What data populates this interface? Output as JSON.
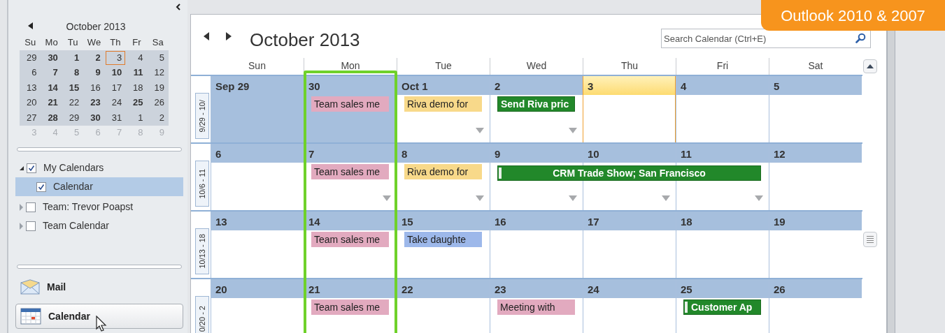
{
  "badge": {
    "text": "Outlook 2010 & 2007"
  },
  "mini_calendar": {
    "title": "October 2013",
    "weekdays": [
      "Su",
      "Mo",
      "Tu",
      "We",
      "Th",
      "Fr",
      "Sa"
    ],
    "weeks": [
      [
        {
          "label": "29",
          "bold": false,
          "today": false,
          "dimmed": false
        },
        {
          "label": "30",
          "bold": true,
          "today": false,
          "dimmed": false
        },
        {
          "label": "1",
          "bold": true,
          "today": false,
          "dimmed": false
        },
        {
          "label": "2",
          "bold": true,
          "today": false,
          "dimmed": false
        },
        {
          "label": "3",
          "bold": false,
          "today": true,
          "dimmed": false
        },
        {
          "label": "4",
          "bold": false,
          "today": false,
          "dimmed": false
        },
        {
          "label": "5",
          "bold": false,
          "today": false,
          "dimmed": false
        }
      ],
      [
        {
          "label": "6",
          "bold": false,
          "today": false,
          "dimmed": false
        },
        {
          "label": "7",
          "bold": true,
          "today": false,
          "dimmed": false
        },
        {
          "label": "8",
          "bold": true,
          "today": false,
          "dimmed": false
        },
        {
          "label": "9",
          "bold": true,
          "today": false,
          "dimmed": false
        },
        {
          "label": "10",
          "bold": true,
          "today": false,
          "dimmed": false
        },
        {
          "label": "11",
          "bold": true,
          "today": false,
          "dimmed": false
        },
        {
          "label": "12",
          "bold": false,
          "today": false,
          "dimmed": false
        }
      ],
      [
        {
          "label": "13",
          "bold": false,
          "today": false,
          "dimmed": false
        },
        {
          "label": "14",
          "bold": true,
          "today": false,
          "dimmed": false
        },
        {
          "label": "15",
          "bold": true,
          "today": false,
          "dimmed": false
        },
        {
          "label": "16",
          "bold": false,
          "today": false,
          "dimmed": false
        },
        {
          "label": "17",
          "bold": false,
          "today": false,
          "dimmed": false
        },
        {
          "label": "18",
          "bold": false,
          "today": false,
          "dimmed": false
        },
        {
          "label": "19",
          "bold": false,
          "today": false,
          "dimmed": false
        }
      ],
      [
        {
          "label": "20",
          "bold": false,
          "today": false,
          "dimmed": false
        },
        {
          "label": "21",
          "bold": true,
          "today": false,
          "dimmed": false
        },
        {
          "label": "22",
          "bold": false,
          "today": false,
          "dimmed": false
        },
        {
          "label": "23",
          "bold": true,
          "today": false,
          "dimmed": false
        },
        {
          "label": "24",
          "bold": false,
          "today": false,
          "dimmed": false
        },
        {
          "label": "25",
          "bold": true,
          "today": false,
          "dimmed": false
        },
        {
          "label": "26",
          "bold": false,
          "today": false,
          "dimmed": false
        }
      ],
      [
        {
          "label": "27",
          "bold": false,
          "today": false,
          "dimmed": false
        },
        {
          "label": "28",
          "bold": true,
          "today": false,
          "dimmed": false
        },
        {
          "label": "29",
          "bold": false,
          "today": false,
          "dimmed": false
        },
        {
          "label": "30",
          "bold": true,
          "today": false,
          "dimmed": false
        },
        {
          "label": "31",
          "bold": false,
          "today": false,
          "dimmed": false
        },
        {
          "label": "1",
          "bold": false,
          "today": false,
          "dimmed": false
        },
        {
          "label": "2",
          "bold": false,
          "today": false,
          "dimmed": false
        }
      ],
      [
        {
          "label": "3",
          "bold": false,
          "today": false,
          "dimmed": true
        },
        {
          "label": "4",
          "bold": false,
          "today": false,
          "dimmed": true
        },
        {
          "label": "5",
          "bold": false,
          "today": false,
          "dimmed": true
        },
        {
          "label": "6",
          "bold": false,
          "today": false,
          "dimmed": true
        },
        {
          "label": "7",
          "bold": false,
          "today": false,
          "dimmed": true
        },
        {
          "label": "8",
          "bold": false,
          "today": false,
          "dimmed": true
        },
        {
          "label": "9",
          "bold": false,
          "today": false,
          "dimmed": true
        }
      ]
    ]
  },
  "calendar_tree": [
    {
      "label": "My Calendars",
      "checked": true,
      "expanded": true,
      "selected": false,
      "children": [
        {
          "label": "Calendar",
          "checked": true,
          "selected": true
        }
      ]
    },
    {
      "label": "Team: Trevor Poapst",
      "checked": false,
      "expanded": false,
      "selected": false
    },
    {
      "label": "Team Calendar",
      "checked": false,
      "expanded": false,
      "selected": false
    }
  ],
  "navigation": [
    {
      "kind": "mail",
      "label": "Mail",
      "selected": false
    },
    {
      "kind": "calendar",
      "label": "Calendar",
      "selected": true
    }
  ],
  "calendar": {
    "title": "October 2013",
    "search": {
      "placeholder": "Search Calendar (Ctrl+E)"
    },
    "day_headers": [
      {
        "label": "Sun",
        "highlighted": false
      },
      {
        "label": "Mon",
        "highlighted": true
      },
      {
        "label": "Tue",
        "highlighted": false
      },
      {
        "label": "Wed",
        "highlighted": false
      },
      {
        "label": "Thu",
        "highlighted": false
      },
      {
        "label": "Fri",
        "highlighted": false
      },
      {
        "label": "Sat",
        "highlighted": false
      }
    ],
    "weeks": [
      {
        "label": "9/29 - 10/",
        "days": [
          {
            "date": "Sep 29",
            "outside": true,
            "today": false,
            "more": false
          },
          {
            "date": "30",
            "outside": true,
            "today": false,
            "more": false,
            "events": [
              {
                "kind": "appointment",
                "title": "Team sales me",
                "color": "#e2aabf",
                "all_day": false
              }
            ]
          },
          {
            "date": "Oct 1",
            "outside": false,
            "today": false,
            "more": true,
            "events": [
              {
                "kind": "appointment",
                "title": "Riva demo for",
                "color": "#f8d98a",
                "all_day": false
              }
            ]
          },
          {
            "date": "2",
            "outside": false,
            "today": false,
            "more": true,
            "events": [
              {
                "kind": "appointment",
                "title": "Send Riva pric",
                "color": "#22882a",
                "all_day": false
              }
            ]
          },
          {
            "date": "3",
            "outside": false,
            "today": true,
            "more": false
          },
          {
            "date": "4",
            "outside": false,
            "today": false,
            "more": false
          },
          {
            "date": "5",
            "outside": false,
            "today": false,
            "more": false
          }
        ]
      },
      {
        "label": "10/6 - 11",
        "days": [
          {
            "date": "6",
            "outside": false,
            "today": false,
            "more": false
          },
          {
            "date": "7",
            "outside": false,
            "today": false,
            "more": true,
            "events": [
              {
                "kind": "appointment",
                "title": "Team sales me",
                "color": "#e2aabf",
                "all_day": false
              }
            ]
          },
          {
            "date": "8",
            "outside": false,
            "today": false,
            "more": true,
            "events": [
              {
                "kind": "appointment",
                "title": "Riva demo for",
                "color": "#f8d98a",
                "all_day": false
              }
            ]
          },
          {
            "date": "9",
            "outside": false,
            "today": false,
            "more": true,
            "events": [
              {
                "kind": "appointment",
                "title": "CRM Trade Show; San Francisco",
                "color": "#22882a",
                "all_day": true
              }
            ]
          },
          {
            "date": "10",
            "outside": false,
            "today": false,
            "more": true,
            "events": [
              {
                "kind": "continuation"
              }
            ]
          },
          {
            "date": "11",
            "outside": false,
            "today": false,
            "more": true,
            "events": [
              {
                "kind": "continuation"
              }
            ]
          },
          {
            "date": "12",
            "outside": false,
            "today": false,
            "more": false
          }
        ]
      },
      {
        "label": "10/13 - 18",
        "days": [
          {
            "date": "13",
            "outside": false,
            "today": false,
            "more": false
          },
          {
            "date": "14",
            "outside": false,
            "today": false,
            "more": false,
            "events": [
              {
                "kind": "appointment",
                "title": "Team sales me",
                "color": "#e2aabf",
                "all_day": false
              }
            ]
          },
          {
            "date": "15",
            "outside": false,
            "today": false,
            "more": false,
            "events": [
              {
                "kind": "appointment",
                "title": "Take daughte",
                "color": "#9db8ea",
                "all_day": false
              }
            ]
          },
          {
            "date": "16",
            "outside": false,
            "today": false,
            "more": false
          },
          {
            "date": "17",
            "outside": false,
            "today": false,
            "more": false
          },
          {
            "date": "18",
            "outside": false,
            "today": false,
            "more": false
          },
          {
            "date": "19",
            "outside": false,
            "today": false,
            "more": false
          }
        ]
      },
      {
        "label": "0/20 - 2",
        "days": [
          {
            "date": "20",
            "outside": false,
            "today": false
          },
          {
            "date": "21",
            "outside": false,
            "today": false,
            "events": [
              {
                "kind": "appointment",
                "title": "Team sales me",
                "color": "#e2aabf",
                "all_day": false
              }
            ]
          },
          {
            "date": "22",
            "outside": false,
            "today": false
          },
          {
            "date": "23",
            "outside": false,
            "today": false,
            "events": [
              {
                "kind": "appointment",
                "title": "Meeting with",
                "color": "#e2aabf",
                "all_day": false
              }
            ]
          },
          {
            "date": "24",
            "outside": false,
            "today": false
          },
          {
            "date": "25",
            "outside": false,
            "today": false,
            "events": [
              {
                "kind": "appointment",
                "title": "Customer Ap",
                "color": "#22882a",
                "all_day": true
              }
            ]
          },
          {
            "date": "26",
            "outside": false,
            "today": false
          }
        ]
      }
    ]
  }
}
